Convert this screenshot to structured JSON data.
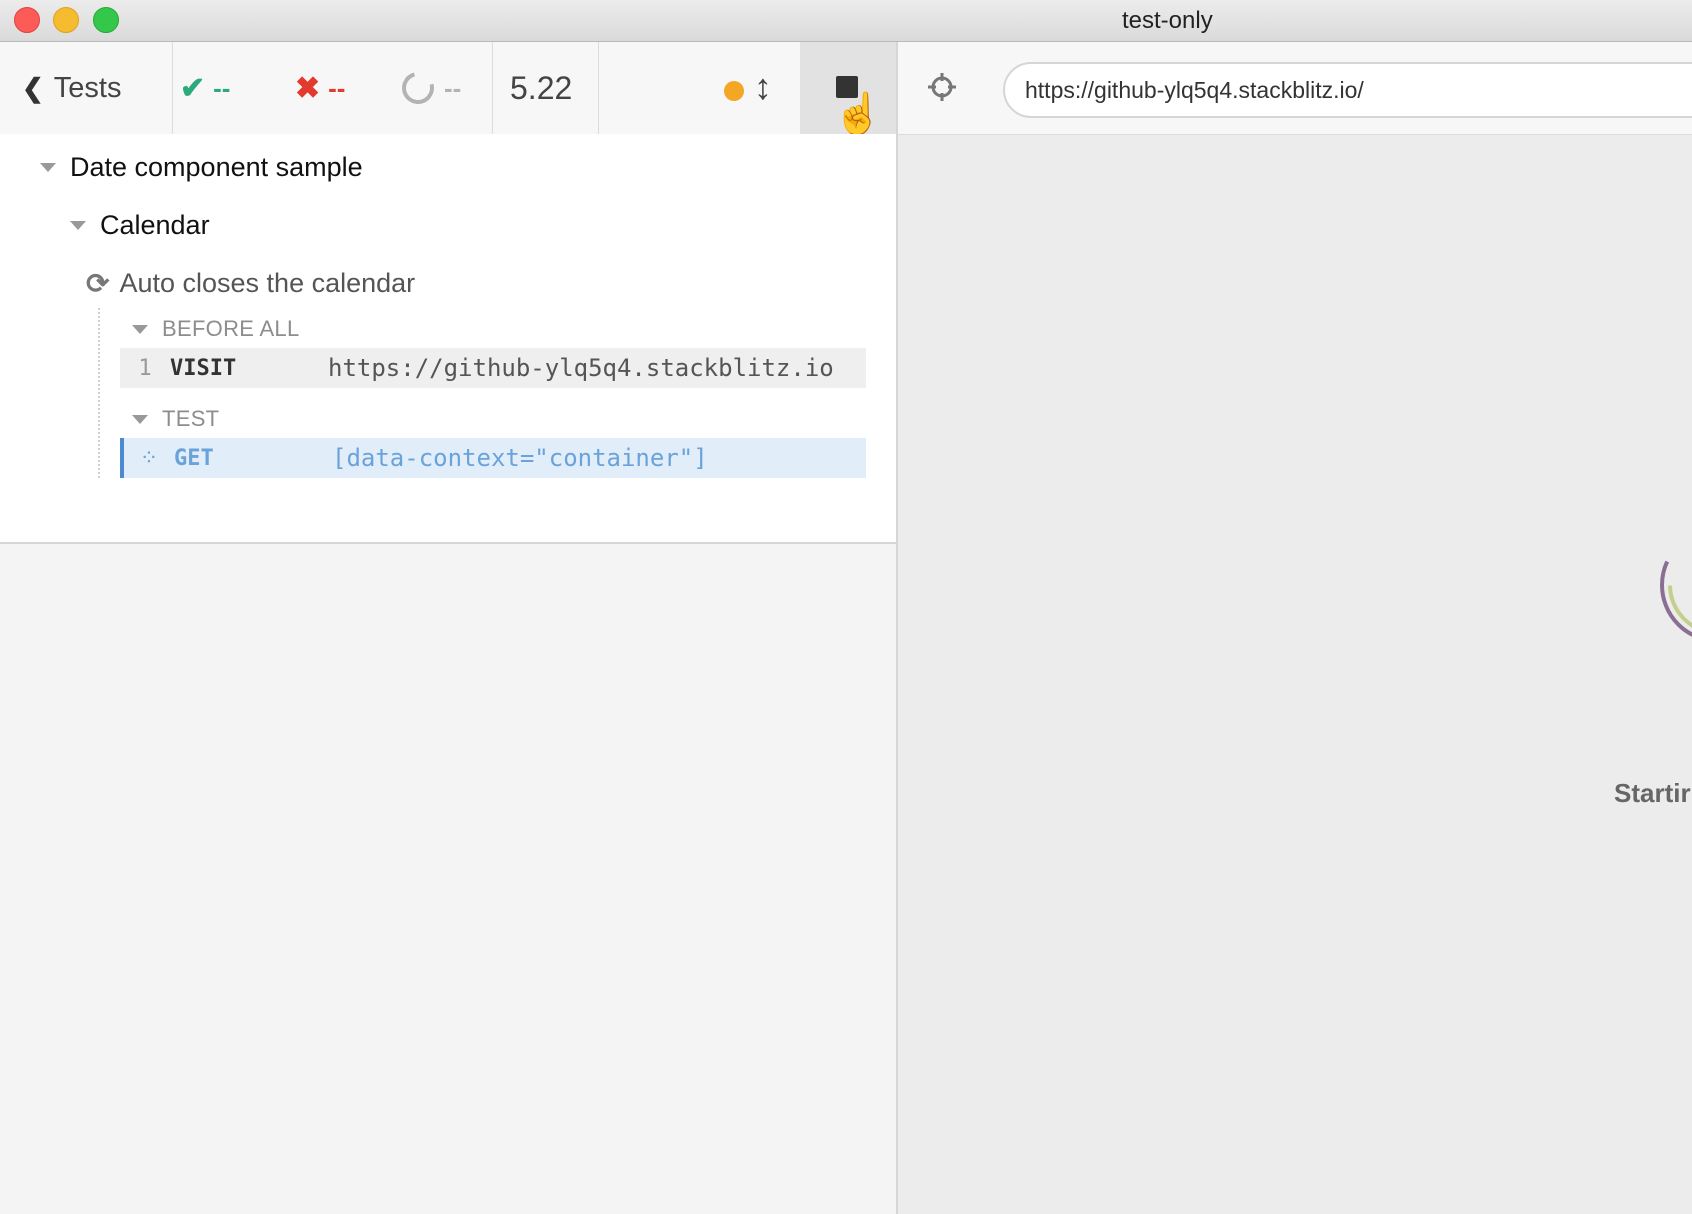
{
  "window": {
    "title": "test-only"
  },
  "reporter": {
    "back_label": "Tests",
    "stats": {
      "passed": "--",
      "failed": "--",
      "pending": "--"
    },
    "duration": "5.22",
    "tree": {
      "suite": "Date component sample",
      "subsuite": "Calendar",
      "test": "Auto closes the calendar",
      "hooks": [
        {
          "title": "BEFORE ALL",
          "commands": [
            {
              "num": "1",
              "name": "VISIT",
              "message": "https://github-ylq5q4.stackblitz.io"
            }
          ]
        },
        {
          "title": "TEST",
          "commands": [
            {
              "num": "",
              "name": "GET",
              "message": "[data-context=\"container\"]"
            }
          ]
        }
      ]
    }
  },
  "aut": {
    "url": "https://github-ylq5q4.stackblitz.io/",
    "status_text": "Startir"
  },
  "colors": {
    "pass": "#2daa7c",
    "fail": "#e33a2f",
    "running": "#f4a724",
    "active_command": "#6aa3d9"
  },
  "icons": [
    "chevron-left-icon",
    "check-icon",
    "x-icon",
    "circle-pending-icon",
    "status-dot-icon",
    "resize-arrows-icon",
    "stop-icon",
    "hand-cursor-icon",
    "caret-down-icon",
    "refresh-icon",
    "spinner-icon",
    "crosshair-icon",
    "loader-rings-icon"
  ]
}
